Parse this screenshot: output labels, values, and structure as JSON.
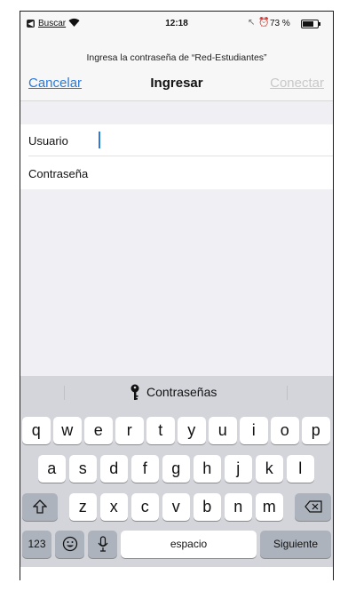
{
  "status_bar": {
    "back_label": "Buscar",
    "time": "12:18",
    "battery_percent": "73 %",
    "battery_level": 0.73
  },
  "prompt": "Ingresa la contraseña de “Red-Estudiantes”",
  "nav": {
    "cancel": "Cancelar",
    "title": "Ingresar",
    "connect": "Conectar"
  },
  "form": {
    "username_label": "Usuario",
    "password_label": "Contraseña"
  },
  "keyboard": {
    "suggestion": "Contraseñas",
    "row1": [
      "q",
      "w",
      "e",
      "r",
      "t",
      "y",
      "u",
      "i",
      "o",
      "p"
    ],
    "row2": [
      "a",
      "s",
      "d",
      "f",
      "g",
      "h",
      "j",
      "k",
      "l"
    ],
    "row3": [
      "z",
      "x",
      "c",
      "v",
      "b",
      "n",
      "m"
    ],
    "numbers_key": "123",
    "space_key": "espacio",
    "return_key": "Siguiente"
  },
  "colors": {
    "accent": "#2b7bd8",
    "disabled": "#c8c8c8",
    "keyboard_bg": "#d3d5db"
  },
  "icons": {
    "back": "back-arrow-icon",
    "wifi": "wifi-icon",
    "location": "location-arrow-icon",
    "alarm": "alarm-icon",
    "battery": "battery-icon",
    "key": "key-icon",
    "shift": "shift-icon",
    "delete": "delete-icon",
    "emoji": "emoji-icon",
    "mic": "microphone-icon"
  }
}
